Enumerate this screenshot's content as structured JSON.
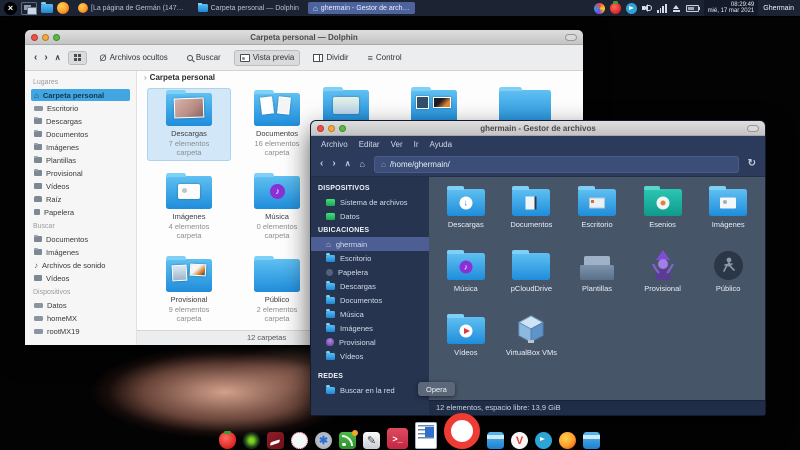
{
  "colors": {
    "accent_blue": "#3daee9",
    "panel_bg": "#1c2434",
    "fm_navy": "#2c3b5c",
    "fm_sidebar": "#263450",
    "fm_view": "#475569",
    "folder_blue": "#2f9ae0",
    "esenios_teal": "#14b0a0"
  },
  "panel": {
    "tasks": [
      {
        "label": "[La página de Germán (147…"
      },
      {
        "label": "Carpeta personal — Dolphin"
      },
      {
        "label": "ghermain - Gestor de arch…"
      }
    ],
    "clock_time": "08:29:49",
    "clock_date": "mié, 17 mar 2021",
    "username": "Ghermain"
  },
  "dolphin": {
    "title": "Carpeta personal — Dolphin",
    "toolbar": {
      "hidden_files": "Archivos ocultos",
      "search": "Buscar",
      "preview": "Vista previa",
      "split": "Dividir",
      "control": "Control"
    },
    "breadcrumb": "Carpeta personal",
    "sidebar": {
      "sections": [
        {
          "title": "Lugares",
          "items": [
            {
              "label": "Carpeta personal"
            },
            {
              "label": "Escritorio"
            },
            {
              "label": "Descargas"
            },
            {
              "label": "Documentos"
            },
            {
              "label": "Imágenes"
            },
            {
              "label": "Plantillas"
            },
            {
              "label": "Provisional"
            },
            {
              "label": "Vídeos"
            },
            {
              "label": "Raíz"
            },
            {
              "label": "Papelera"
            }
          ]
        },
        {
          "title": "Buscar",
          "items": [
            {
              "label": "Documentos"
            },
            {
              "label": "Imágenes"
            },
            {
              "label": "Archivos de sonido"
            },
            {
              "label": "Vídeos"
            }
          ]
        },
        {
          "title": "Dispositivos",
          "items": [
            {
              "label": "Datos"
            },
            {
              "label": "homeMX"
            },
            {
              "label": "rootMX19"
            }
          ]
        }
      ]
    },
    "folders": [
      {
        "name": "Descargas",
        "count": "7 elementos",
        "kind": "carpeta"
      },
      {
        "name": "Documentos",
        "count": "16 elementos",
        "kind": "carpeta"
      },
      {
        "name": "Imágenes",
        "count": "4 elementos",
        "kind": "carpeta"
      },
      {
        "name": "Música",
        "count": "0 elementos",
        "kind": "carpeta"
      },
      {
        "name": "Provisional",
        "count": "9 elementos",
        "kind": "carpeta"
      },
      {
        "name": "Público",
        "count": "2 elementos",
        "kind": "carpeta"
      }
    ],
    "status": "12 carpetas"
  },
  "fm": {
    "title": "ghermain - Gestor de archivos",
    "menus": [
      "Archivo",
      "Editar",
      "Ver",
      "Ir",
      "Ayuda"
    ],
    "path": "/home/ghermain/",
    "sidebar": {
      "sections": [
        {
          "title": "DISPOSITIVOS",
          "items": [
            {
              "label": "Sistema de archivos"
            },
            {
              "label": "Datos"
            }
          ]
        },
        {
          "title": "UBICACIONES",
          "items": [
            {
              "label": "ghermain"
            },
            {
              "label": "Escritorio"
            },
            {
              "label": "Papelera"
            },
            {
              "label": "Descargas"
            },
            {
              "label": "Documentos"
            },
            {
              "label": "Música"
            },
            {
              "label": "Imágenes"
            },
            {
              "label": "Provisional"
            },
            {
              "label": "Vídeos"
            }
          ]
        },
        {
          "title": "REDES",
          "items": [
            {
              "label": "Buscar en la red"
            }
          ]
        }
      ]
    },
    "items": [
      {
        "name": "Descargas"
      },
      {
        "name": "Documentos"
      },
      {
        "name": "Escritorio"
      },
      {
        "name": "Esenios"
      },
      {
        "name": "Imágenes"
      },
      {
        "name": "Música"
      },
      {
        "name": "pCloudDrive"
      },
      {
        "name": "Plantillas"
      },
      {
        "name": "Provisional"
      },
      {
        "name": "Público"
      },
      {
        "name": "Vídeos"
      },
      {
        "name": "VirtualBox VMs"
      }
    ],
    "status": "12 elementos, espacio libre: 13,9 GiB"
  },
  "tooltip": "Opera"
}
